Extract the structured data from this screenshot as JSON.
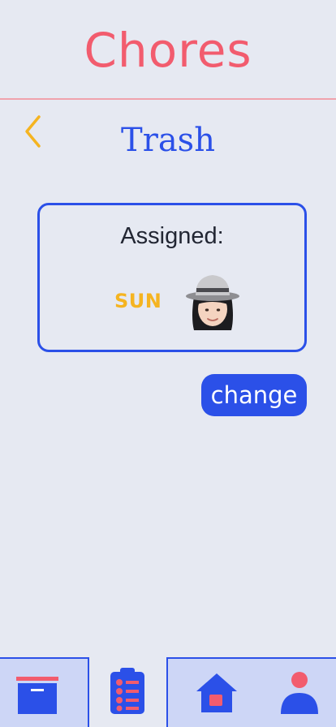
{
  "header": {
    "app_title": "Chores",
    "page_title": "Trash"
  },
  "assigned": {
    "label": "Assigned:",
    "day": "SUN"
  },
  "actions": {
    "change_label": "change"
  },
  "tab_bar": {
    "tabs": [
      {
        "icon": "archive-icon",
        "active": false
      },
      {
        "icon": "chore-list-icon",
        "active": true
      },
      {
        "icon": "home-icon",
        "active": false
      },
      {
        "icon": "profile-icon",
        "active": false
      }
    ]
  },
  "colors": {
    "accent_blue": "#2b50e8",
    "title_pink": "#f25c6e",
    "day_yellow": "#f5b421",
    "background": "#e6e9f2",
    "tab_bar_fill": "#cdd6f6"
  }
}
